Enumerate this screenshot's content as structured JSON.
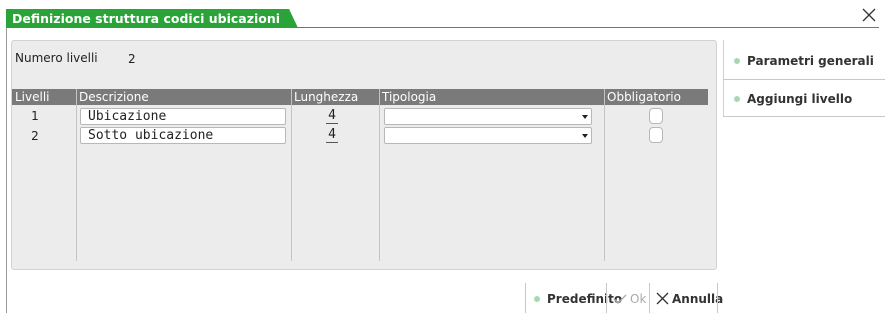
{
  "window": {
    "title": "Definizione struttura codici ubicazioni",
    "close_icon": "close-x-icon",
    "accent_color": "#2aa338"
  },
  "form": {
    "numero_livelli_label": "Numero livelli",
    "numero_livelli_value": "2"
  },
  "grid": {
    "columns": [
      "Livelli",
      "Descrizione",
      "Lunghezza",
      "Tipologia",
      "Obbligatorio"
    ],
    "rows": [
      {
        "livello": "1",
        "descrizione": "Ubicazione",
        "lunghezza": "4",
        "tipologia": "",
        "obbligatorio": false
      },
      {
        "livello": "2",
        "descrizione": "Sotto ubicazione",
        "lunghezza": "4",
        "tipologia": "",
        "obbligatorio": false
      }
    ]
  },
  "side_menu": {
    "items": [
      "Parametri generali",
      "Aggiungi livello"
    ]
  },
  "footer": {
    "predefinito": "Predefinito",
    "ok": "Ok",
    "annulla": "Annulla"
  }
}
